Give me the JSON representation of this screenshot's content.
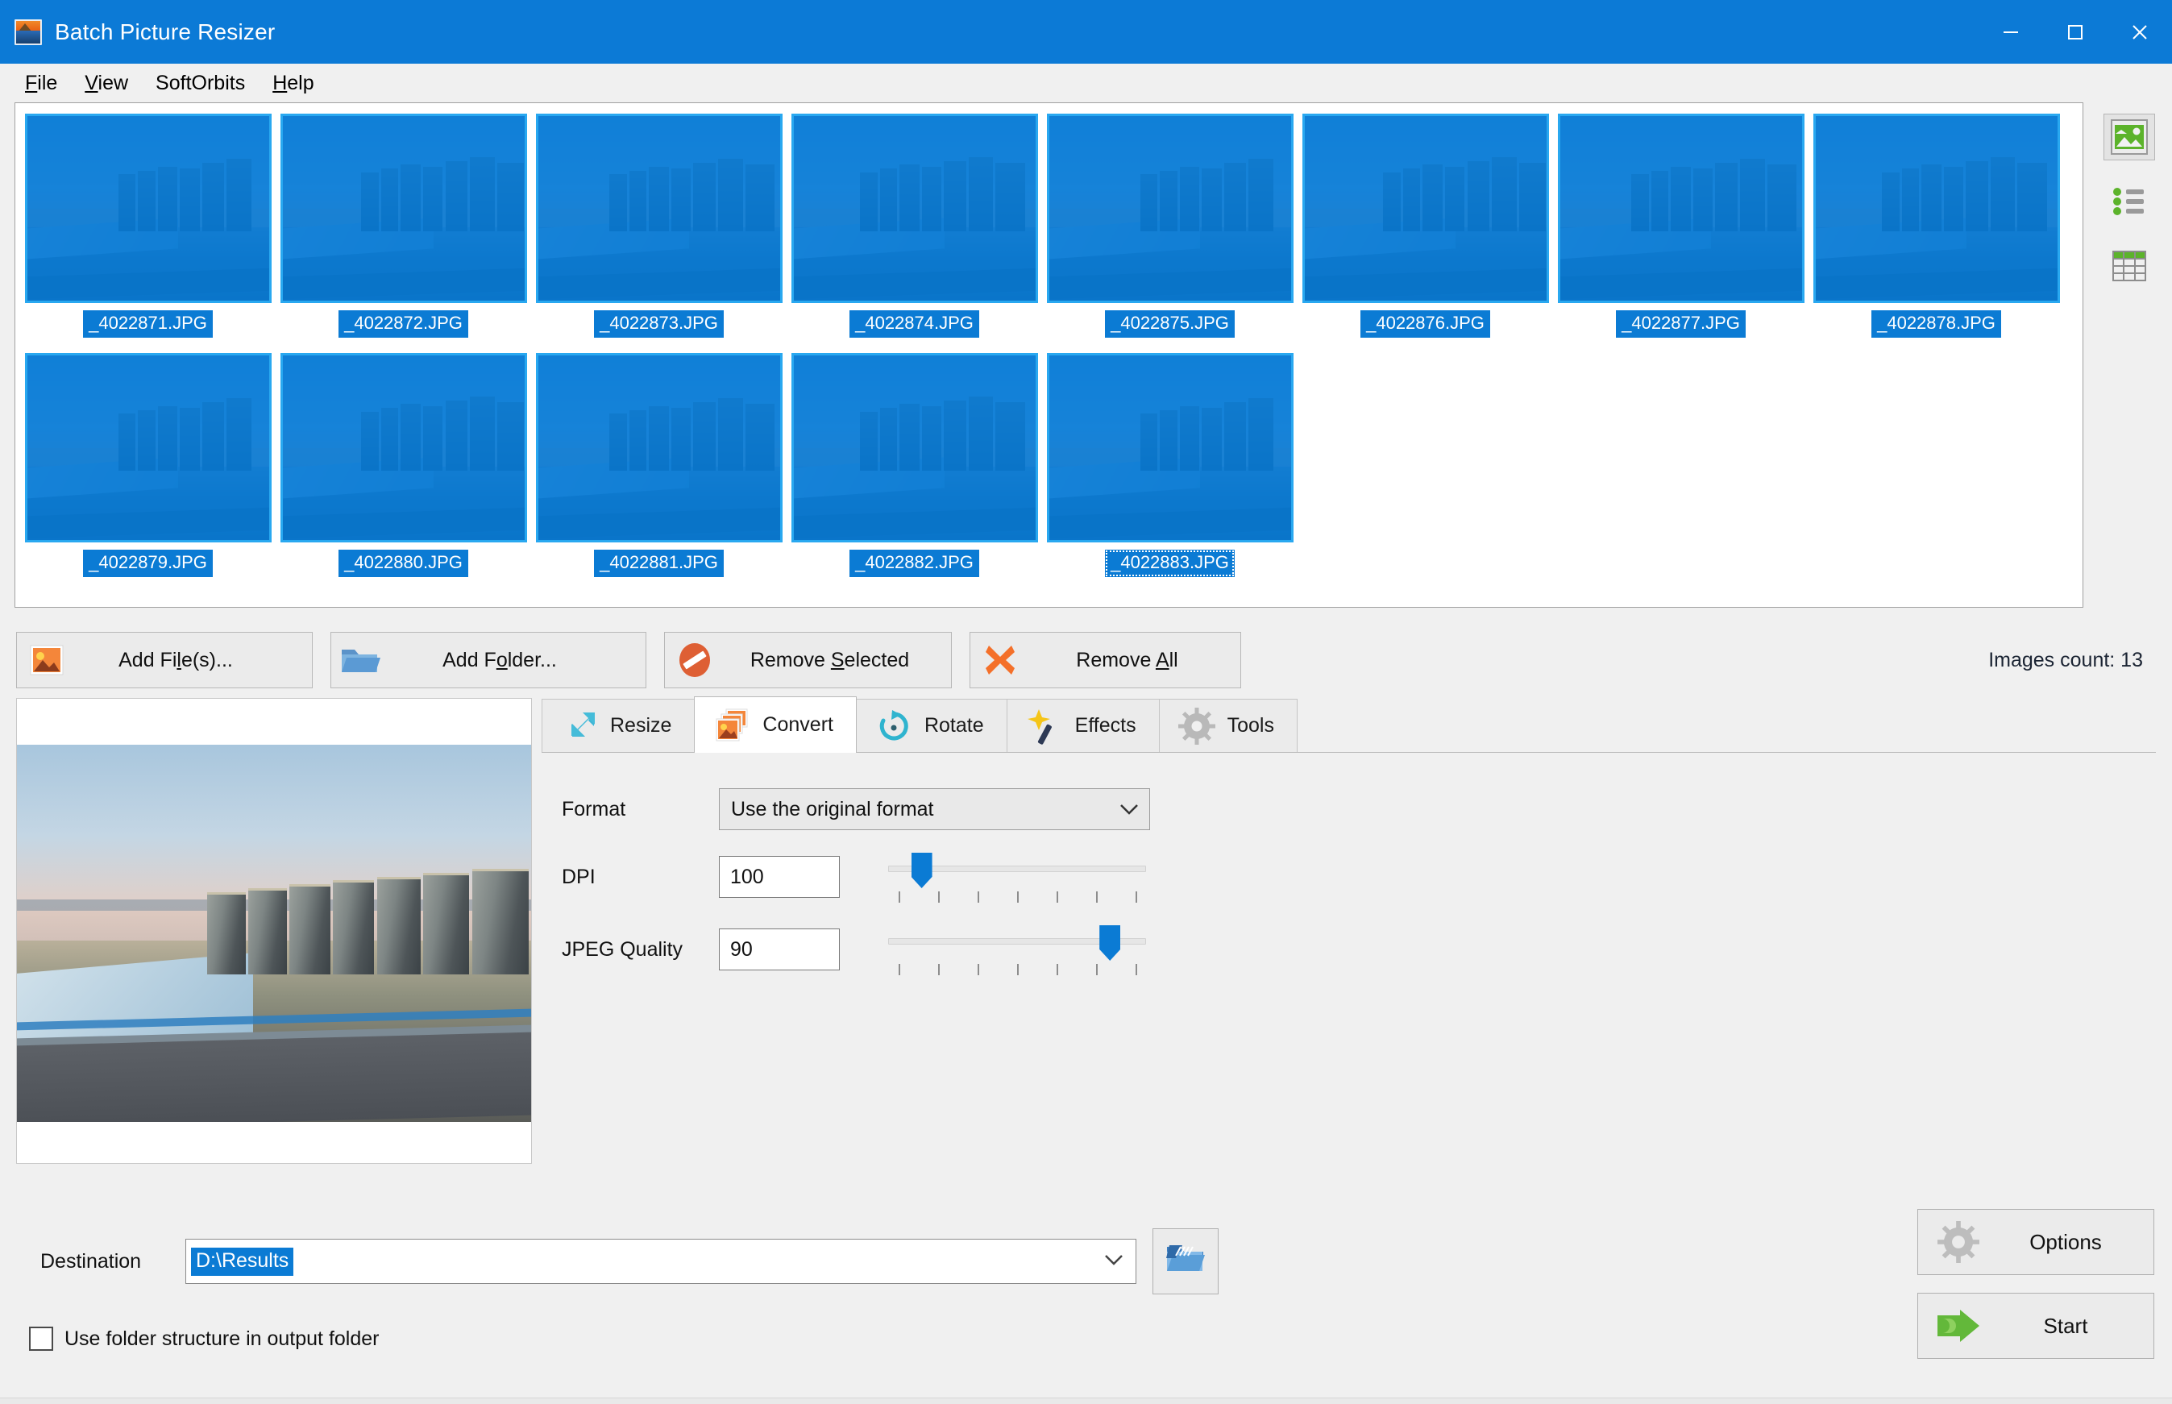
{
  "window": {
    "title": "Batch Picture Resizer",
    "icon": "app-picture-icon",
    "controls": {
      "minimize": "minimize-icon",
      "maximize": "maximize-icon",
      "close": "close-icon"
    },
    "titlebar_color": "#0c7ad6"
  },
  "menu": [
    {
      "label": "File",
      "accel": "F"
    },
    {
      "label": "View",
      "accel": "V"
    },
    {
      "label": "SoftOrbits",
      "accel": ""
    },
    {
      "label": "Help",
      "accel": "H"
    }
  ],
  "thumbnails": [
    {
      "filename": "_4022871.JPG",
      "selected": true,
      "focused": false
    },
    {
      "filename": "_4022872.JPG",
      "selected": true,
      "focused": false
    },
    {
      "filename": "_4022873.JPG",
      "selected": true,
      "focused": false
    },
    {
      "filename": "_4022874.JPG",
      "selected": true,
      "focused": false
    },
    {
      "filename": "_4022875.JPG",
      "selected": true,
      "focused": false
    },
    {
      "filename": "_4022876.JPG",
      "selected": true,
      "focused": false
    },
    {
      "filename": "_4022877.JPG",
      "selected": true,
      "focused": false
    },
    {
      "filename": "_4022878.JPG",
      "selected": true,
      "focused": false
    },
    {
      "filename": "_4022879.JPG",
      "selected": true,
      "focused": false
    },
    {
      "filename": "_4022880.JPG",
      "selected": true,
      "focused": false
    },
    {
      "filename": "_4022881.JPG",
      "selected": true,
      "focused": false
    },
    {
      "filename": "_4022882.JPG",
      "selected": true,
      "focused": false
    },
    {
      "filename": "_4022883.JPG",
      "selected": true,
      "focused": true
    }
  ],
  "view_modes": [
    {
      "name": "thumbnail-view",
      "icon": "picture-icon",
      "active": true
    },
    {
      "name": "list-view",
      "icon": "bullet-list-icon",
      "active": false
    },
    {
      "name": "details-view",
      "icon": "table-grid-icon",
      "active": false
    }
  ],
  "actions": {
    "add_files": {
      "label": "Add File(s)...",
      "accel": "l",
      "icon": "picture-add-icon"
    },
    "add_folder": {
      "label": "Add Folder...",
      "accel": "o",
      "icon": "folder-open-icon"
    },
    "remove_selected": {
      "label": "Remove Selected",
      "accel": "S",
      "icon": "no-entry-icon"
    },
    "remove_all": {
      "label": "Remove All",
      "accel": "A",
      "icon": "x-cross-icon"
    },
    "images_count": "Images count: 13"
  },
  "tabs": [
    {
      "label": "Resize",
      "icon": "resize-arrows-icon",
      "active": false
    },
    {
      "label": "Convert",
      "icon": "convert-pictures-icon",
      "active": true
    },
    {
      "label": "Rotate",
      "icon": "rotate-circle-icon",
      "active": false
    },
    {
      "label": "Effects",
      "icon": "magic-wand-icon",
      "active": false
    },
    {
      "label": "Tools",
      "icon": "gear-icon",
      "active": false
    }
  ],
  "convert_panel": {
    "format": {
      "label": "Format",
      "value": "Use the original format",
      "arrow": "chevron-down-icon"
    },
    "dpi": {
      "label": "DPI",
      "value": "100",
      "slider_percent": 13,
      "ticks": 7
    },
    "jpeg_quality": {
      "label": "JPEG Quality",
      "value": "90",
      "slider_percent": 86,
      "ticks": 7
    }
  },
  "footer": {
    "destination_label": "Destination",
    "destination_value": "D:\\Results",
    "destination_arrow": "chevron-down-icon",
    "browse_icon": "folder-browse-icon",
    "checkbox_label": "Use folder structure in output folder",
    "checkbox_checked": false,
    "options_button": {
      "label": "Options",
      "icon": "gear-icon"
    },
    "start_button": {
      "label": "Start",
      "icon": "green-arrow-icon"
    }
  },
  "colors": {
    "titlebar": "#0c7ad6",
    "selection": "#0b7bd4",
    "window_bg": "#f0f0f0",
    "accent_green": "#5cb32b",
    "accent_orange": "#e8702a"
  }
}
